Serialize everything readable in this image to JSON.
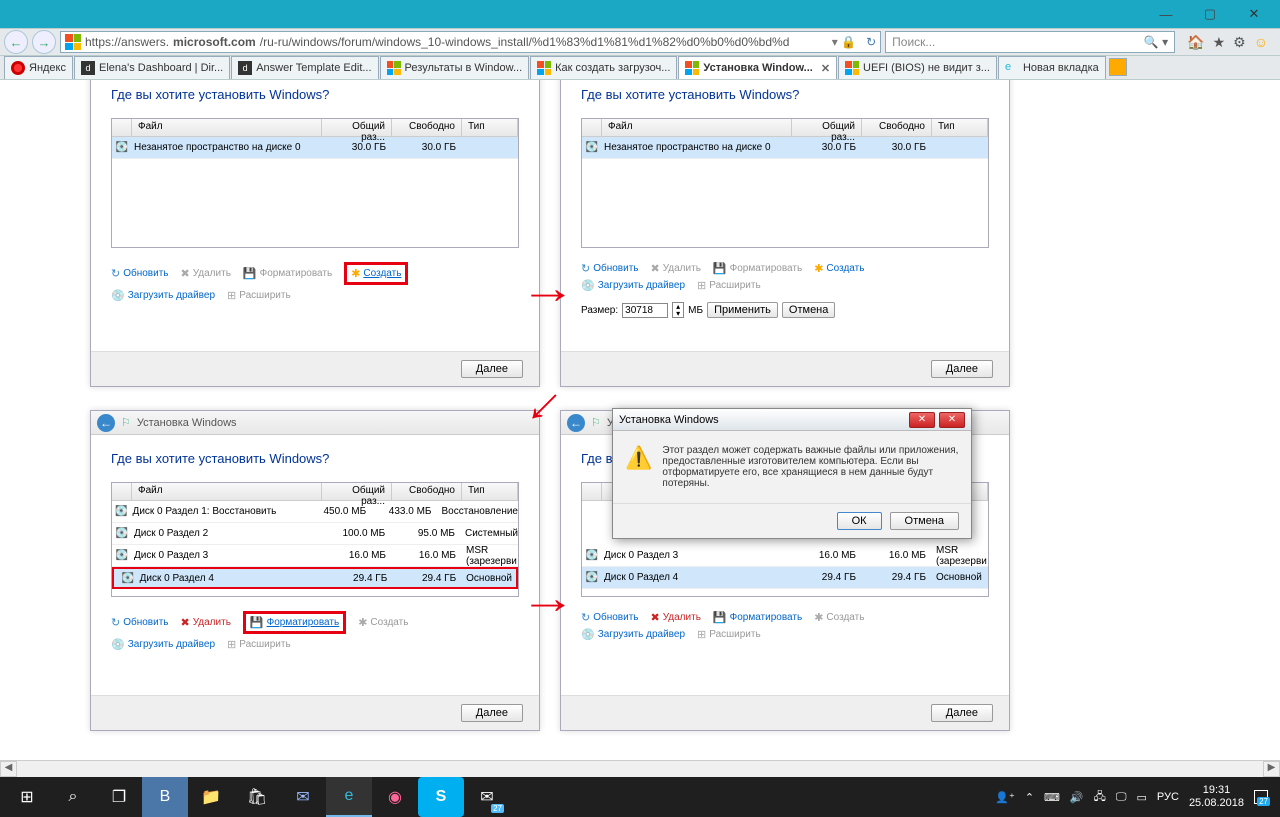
{
  "window_controls": {
    "min": "—",
    "max": "▢",
    "close": "✕"
  },
  "browser": {
    "url": "https://answers.microsoft.com/ru-ru/windows/forum/windows_10-windows_install/%d1%83%d1%81%d1%82%d0%b0%d0%bd%d",
    "url_prefix": "https://answers.",
    "url_bold": "microsoft.com",
    "url_rest": "/ru-ru/windows/forum/windows_10-windows_install/%d1%83%d1%81%d1%82%d0%b0%d0%bd%d",
    "search_placeholder": "Поиск..."
  },
  "tabs": [
    {
      "label": "Яндекс",
      "icon": "ya"
    },
    {
      "label": "Elena's Dashboard | Dir...",
      "icon": "d"
    },
    {
      "label": "Answer Template Edit...",
      "icon": "d"
    },
    {
      "label": "Результаты в Window...",
      "icon": "ms"
    },
    {
      "label": "Как создать загрузоч...",
      "icon": "ms"
    },
    {
      "label": "Установка Window...",
      "icon": "ms",
      "active": true
    },
    {
      "label": "UEFI (BIOS) не видит з...",
      "icon": "ms"
    },
    {
      "label": "Новая вкладка",
      "icon": "ie"
    }
  ],
  "installer": {
    "window_title": "Установка Windows",
    "heading": "Где вы хотите установить Windows?",
    "cols": {
      "name": "Файл",
      "size": "Общий раз...",
      "free": "Свободно",
      "type": "Тип"
    },
    "unallocated_row": {
      "name": "Незанятое пространство на диске 0",
      "size": "30.0 ГБ",
      "free": "30.0 ГБ",
      "type": ""
    },
    "partitions": [
      {
        "name": "Диск 0 Раздел 1: Восстановить",
        "size": "450.0 МБ",
        "free": "433.0 МБ",
        "type": "Восстановление"
      },
      {
        "name": "Диск 0 Раздел 2",
        "size": "100.0 МБ",
        "free": "95.0 МБ",
        "type": "Системный"
      },
      {
        "name": "Диск 0 Раздел 3",
        "size": "16.0 МБ",
        "free": "16.0 МБ",
        "type": "MSR (зарезерви"
      },
      {
        "name": "Диск 0 Раздел 4",
        "size": "29.4 ГБ",
        "free": "29.4 ГБ",
        "type": "Основной"
      }
    ],
    "tools": {
      "refresh": "Обновить",
      "delete": "Удалить",
      "format": "Форматировать",
      "create": "Создать",
      "load": "Загрузить драйвер",
      "extend": "Расширить"
    },
    "size_label": "Размер:",
    "size_value": "30718",
    "size_unit": "МБ",
    "apply": "Применить",
    "cancel": "Отмена",
    "next": "Далее"
  },
  "popup": {
    "title": "Установка Windows",
    "text": "Этот раздел может содержать важные файлы или приложения, предоставленные изготовителем компьютера. Если вы отформатируете его, все хранящиеся в нем данные будут потеряны.",
    "ok": "ОК",
    "cancel": "Отмена"
  },
  "taskbar": {
    "time": "19:31",
    "date": "25.08.2018",
    "lang": "РУС",
    "badge": "27",
    "dateicon": "27"
  }
}
